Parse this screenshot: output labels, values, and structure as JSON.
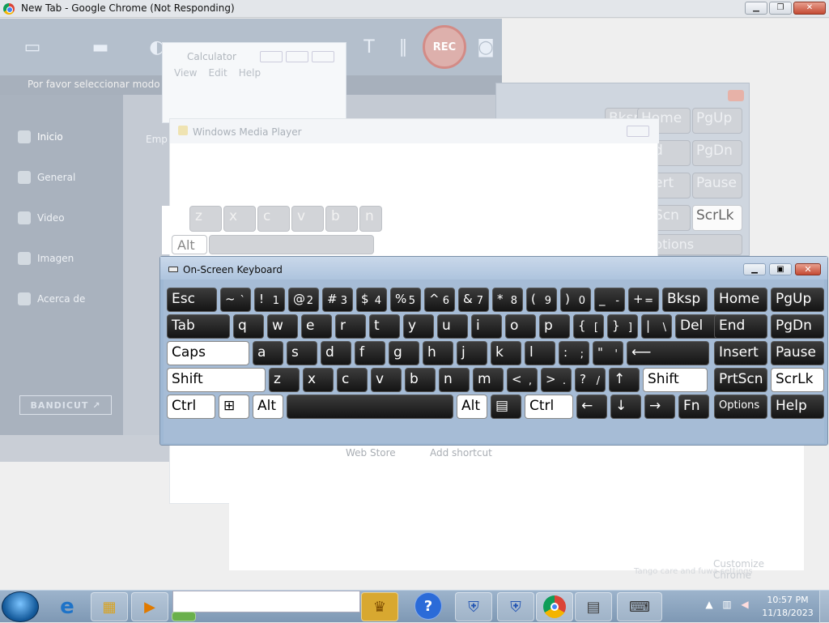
{
  "chrome": {
    "title": "New Tab - Google Chrome (Not Responding)",
    "web_store": "Web Store",
    "add_shortcut": "Add shortcut",
    "customize": "Customize Chrome",
    "faint_text": "Tango care and fuwa settings"
  },
  "bandicam": {
    "rec_label": "REC",
    "mode_text": "Por favor seleccionar modo de",
    "main_tab": "Emp",
    "bandicut": "BANDICUT ↗",
    "sidebar": [
      {
        "label": "Inicio",
        "icon": "home-icon"
      },
      {
        "label": "General",
        "icon": "gear-icon"
      },
      {
        "label": "Video",
        "icon": "video-icon"
      },
      {
        "label": "Imagen",
        "icon": "image-icon"
      },
      {
        "label": "Acerca de",
        "icon": "info-icon"
      }
    ]
  },
  "calculator": {
    "title": "Calculator",
    "menu": [
      "View",
      "Edit",
      "Help"
    ]
  },
  "wmp": {
    "title": "Windows Media Player"
  },
  "bg_osk": {
    "keys": [
      "Bksp",
      "Home",
      "PgUp",
      "d",
      "PgDn",
      "ert",
      "Pause",
      "Scn",
      "ScrLk",
      "ptions"
    ]
  },
  "partial_keys": {
    "keys": [
      "z",
      "x",
      "c",
      "v",
      "b",
      "n",
      "Alt"
    ]
  },
  "osk": {
    "title": "On-Screen Keyboard",
    "row1": [
      {
        "main": "Esc"
      },
      {
        "main": "~",
        "alt": "`"
      },
      {
        "main": "!",
        "alt": "1"
      },
      {
        "main": "@",
        "alt": "2"
      },
      {
        "main": "#",
        "alt": "3"
      },
      {
        "main": "$",
        "alt": "4"
      },
      {
        "main": "%",
        "alt": "5"
      },
      {
        "main": "^",
        "alt": "6"
      },
      {
        "main": "&",
        "alt": "7"
      },
      {
        "main": "*",
        "alt": "8"
      },
      {
        "main": "(",
        "alt": "9"
      },
      {
        "main": ")",
        "alt": "0"
      },
      {
        "main": "_",
        "alt": "-"
      },
      {
        "main": "+",
        "alt": "="
      },
      {
        "main": "Bksp"
      },
      {
        "main": "Home"
      },
      {
        "main": "PgUp"
      }
    ],
    "row2": [
      {
        "main": "Tab"
      },
      {
        "main": "q"
      },
      {
        "main": "w"
      },
      {
        "main": "e"
      },
      {
        "main": "r"
      },
      {
        "main": "t"
      },
      {
        "main": "y"
      },
      {
        "main": "u"
      },
      {
        "main": "i"
      },
      {
        "main": "o"
      },
      {
        "main": "p"
      },
      {
        "main": "{",
        "alt": "["
      },
      {
        "main": "}",
        "alt": "]"
      },
      {
        "main": "|",
        "alt": "\\"
      },
      {
        "main": "Del"
      },
      {
        "main": "End"
      },
      {
        "main": "PgDn"
      }
    ],
    "row3": [
      {
        "main": "Caps"
      },
      {
        "main": "a"
      },
      {
        "main": "s"
      },
      {
        "main": "d"
      },
      {
        "main": "f"
      },
      {
        "main": "g"
      },
      {
        "main": "h"
      },
      {
        "main": "j"
      },
      {
        "main": "k"
      },
      {
        "main": "l"
      },
      {
        "main": ":",
        "alt": ";"
      },
      {
        "main": "\"",
        "alt": "'"
      },
      {
        "main": "⟵"
      },
      {
        "main": "Insert"
      },
      {
        "main": "Pause"
      }
    ],
    "row4": [
      {
        "main": "Shift"
      },
      {
        "main": "z"
      },
      {
        "main": "x"
      },
      {
        "main": "c"
      },
      {
        "main": "v"
      },
      {
        "main": "b"
      },
      {
        "main": "n"
      },
      {
        "main": "m"
      },
      {
        "main": "<",
        "alt": ","
      },
      {
        "main": ">",
        "alt": "."
      },
      {
        "main": "?",
        "alt": "/"
      },
      {
        "main": "↑"
      },
      {
        "main": "Shift"
      },
      {
        "main": "PrtScn"
      },
      {
        "main": "ScrLk"
      }
    ],
    "row5": [
      {
        "main": "Ctrl"
      },
      {
        "main": "⊞"
      },
      {
        "main": "Alt"
      },
      {
        "main": ""
      },
      {
        "main": "Alt"
      },
      {
        "main": "▤"
      },
      {
        "main": "Ctrl"
      },
      {
        "main": "←"
      },
      {
        "main": "↓"
      },
      {
        "main": "→"
      },
      {
        "main": "Fn"
      },
      {
        "main": "Options"
      },
      {
        "main": "Help"
      }
    ]
  },
  "taskbar": {
    "time": "10:57 PM",
    "date": "11/18/2023"
  }
}
